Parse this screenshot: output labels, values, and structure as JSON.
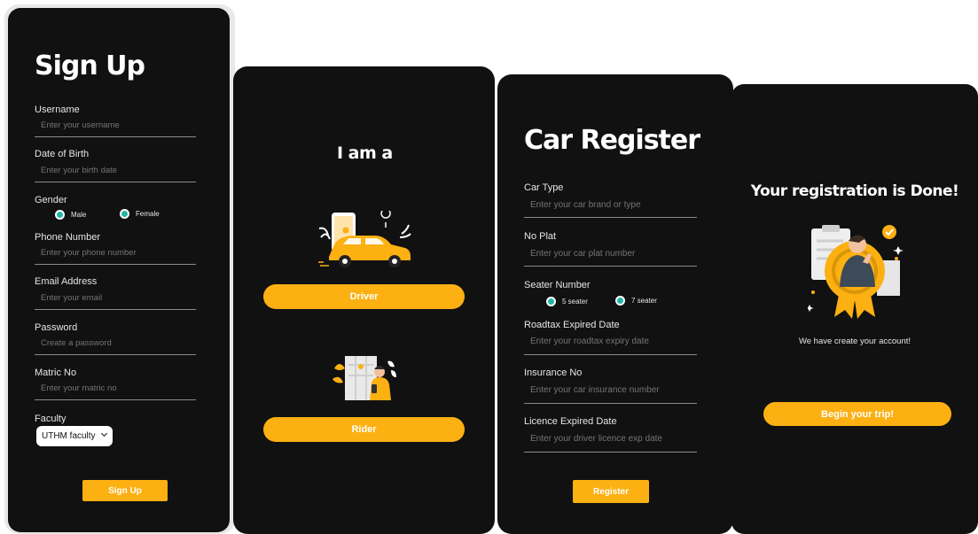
{
  "signup": {
    "title": "Sign Up",
    "username": {
      "label": "Username",
      "placeholder": "Enter your username"
    },
    "dob": {
      "label": "Date of Birth",
      "placeholder": "Enter your birth date"
    },
    "gender": {
      "label": "Gender",
      "options": [
        "Male",
        "Female"
      ]
    },
    "phone": {
      "label": "Phone Number",
      "placeholder": "Enter your phone number"
    },
    "email": {
      "label": "Email Address",
      "placeholder": "Enter your email"
    },
    "password": {
      "label": "Password",
      "placeholder": "Create a password"
    },
    "matric": {
      "label": "Matric No",
      "placeholder": "Enter your matric no"
    },
    "faculty": {
      "label": "Faculty",
      "selected": "UTHM faculty"
    },
    "submit_label": "Sign Up"
  },
  "role": {
    "title": "I am a",
    "driver_label": "Driver",
    "rider_label": "Rider"
  },
  "car": {
    "title": "Car Register",
    "car_type": {
      "label": "Car Type",
      "placeholder": "Enter your car brand or type"
    },
    "plate": {
      "label": "No Plat",
      "placeholder": "Enter your car plat number"
    },
    "seater": {
      "label": "Seater Number",
      "options": [
        "5 seater",
        "7 seater"
      ]
    },
    "roadtax": {
      "label": "Roadtax Expired Date",
      "placeholder": "Enter your roadtax expiry date"
    },
    "insurance": {
      "label": "Insurance No",
      "placeholder": "Enter your car insurance number"
    },
    "licence": {
      "label": "Licence Expired Date",
      "placeholder": "Enter your driver licence exp date"
    },
    "submit_label": "Register"
  },
  "done": {
    "title": "Your registration is Done!",
    "message": "We have create your account!",
    "button_label": "Begin your trip!"
  },
  "colors": {
    "panel": "#111111",
    "accent": "#fcb012",
    "radio": "#22b5a8"
  }
}
